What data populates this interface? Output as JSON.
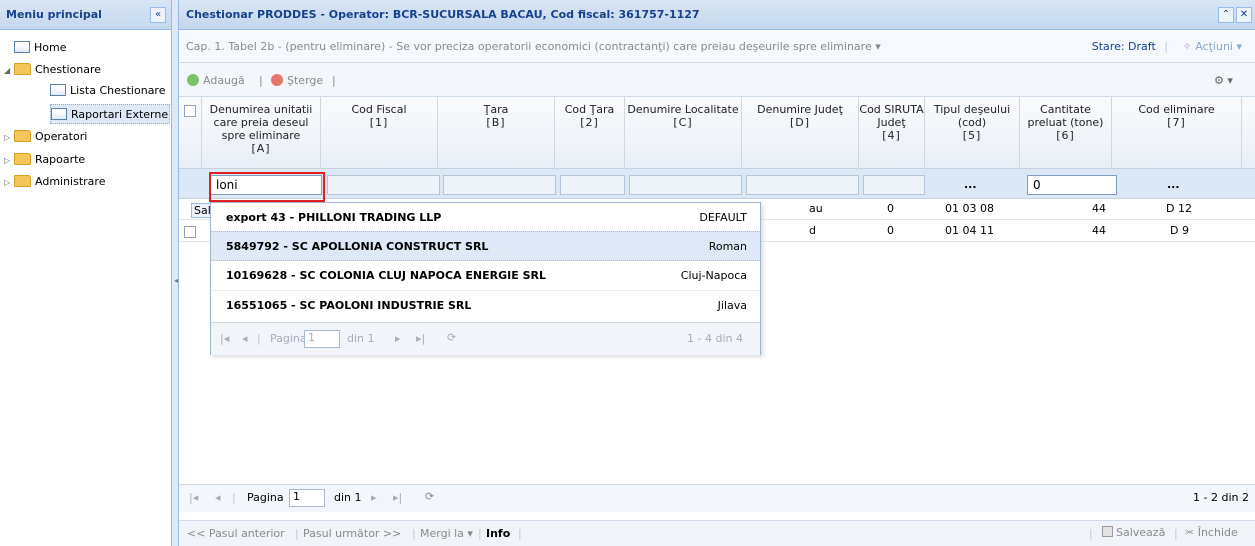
{
  "sidebar": {
    "title": "Meniu principal",
    "collapse_glyph": "«",
    "items": [
      {
        "label": "Home"
      },
      {
        "label": "Chestionare"
      },
      {
        "label": "Lista Chestionare"
      },
      {
        "label": "Raportari Externe"
      },
      {
        "label": "Operatori"
      },
      {
        "label": "Rapoarte"
      },
      {
        "label": "Administrare"
      }
    ]
  },
  "panel": {
    "title": "Chestionar PRODDES - Operator: BCR-SUCURSALA BACAU, Cod fiscal: 361757-1127",
    "subtitle": "Cap. 1. Tabel 2b - (pentru eliminare) - Se vor preciza operatorii economici (contractanţi) care preiau deşeurile spre eliminare ▾",
    "status": "Stare: Draft",
    "actions": "Acţiuni ▾"
  },
  "toolbar": {
    "add": "Adaugă",
    "delete": "Şterge",
    "gear": "⚙ ▾"
  },
  "columns": [
    {
      "name": "Denumirea unitatii care preia deseul spre eliminare",
      "code": "[A]"
    },
    {
      "name": "Cod Fiscal",
      "code": "[1]"
    },
    {
      "name": "Ţara",
      "code": "[B]"
    },
    {
      "name": "Cod Ţara",
      "code": "[2]"
    },
    {
      "name": "Denumire Localitate",
      "code": "[C]"
    },
    {
      "name": "Denumire Judeţ",
      "code": "[D]"
    },
    {
      "name": "Cod SIRUTA Judeţ",
      "code": "[4]"
    },
    {
      "name": "Tipul deşeului (cod)",
      "code": "[5]"
    },
    {
      "name": "Cantitate preluat (tone)",
      "code": "[6]"
    },
    {
      "name": "Cod eliminare",
      "code": "[7]"
    }
  ],
  "filters": {
    "name_value": "loni",
    "ellipsis": "...",
    "quantity_value": "0"
  },
  "rows": [
    {
      "prefix": "Sal",
      "judet": "au",
      "siruta": "0",
      "waste": "01 03 08",
      "qty": "44",
      "elim": "D 12"
    },
    {
      "prefix": "",
      "judet": "d",
      "siruta": "0",
      "waste": "01 04 11",
      "qty": "44",
      "elim": "D 9"
    }
  ],
  "dropdown": {
    "items": [
      {
        "name": "export 43 - PHILLONI TRADING LLP",
        "loc": "DEFAULT"
      },
      {
        "name": "5849792 - SC APOLLONIA CONSTRUCT SRL",
        "loc": "Roman"
      },
      {
        "name": "10169628 - SC COLONIA CLUJ NAPOCA ENERGIE SRL",
        "loc": "Cluj-Napoca"
      },
      {
        "name": "16551065 - SC PAOLONI INDUSTRIE SRL",
        "loc": "Jilava"
      }
    ],
    "pager": {
      "page_label": "Pagina",
      "page": "1",
      "of": "din 1",
      "range": "1 - 4 din 4"
    }
  },
  "pager": {
    "page_label": "Pagina",
    "page": "1",
    "of": "din 1",
    "range": "1 - 2 din 2"
  },
  "footer": {
    "prev": "<< Pasul anterior",
    "next": "Pasul următor >>",
    "goto": "Mergi la ▾",
    "info": "Info",
    "save": "Salvează",
    "close": "Închide"
  }
}
